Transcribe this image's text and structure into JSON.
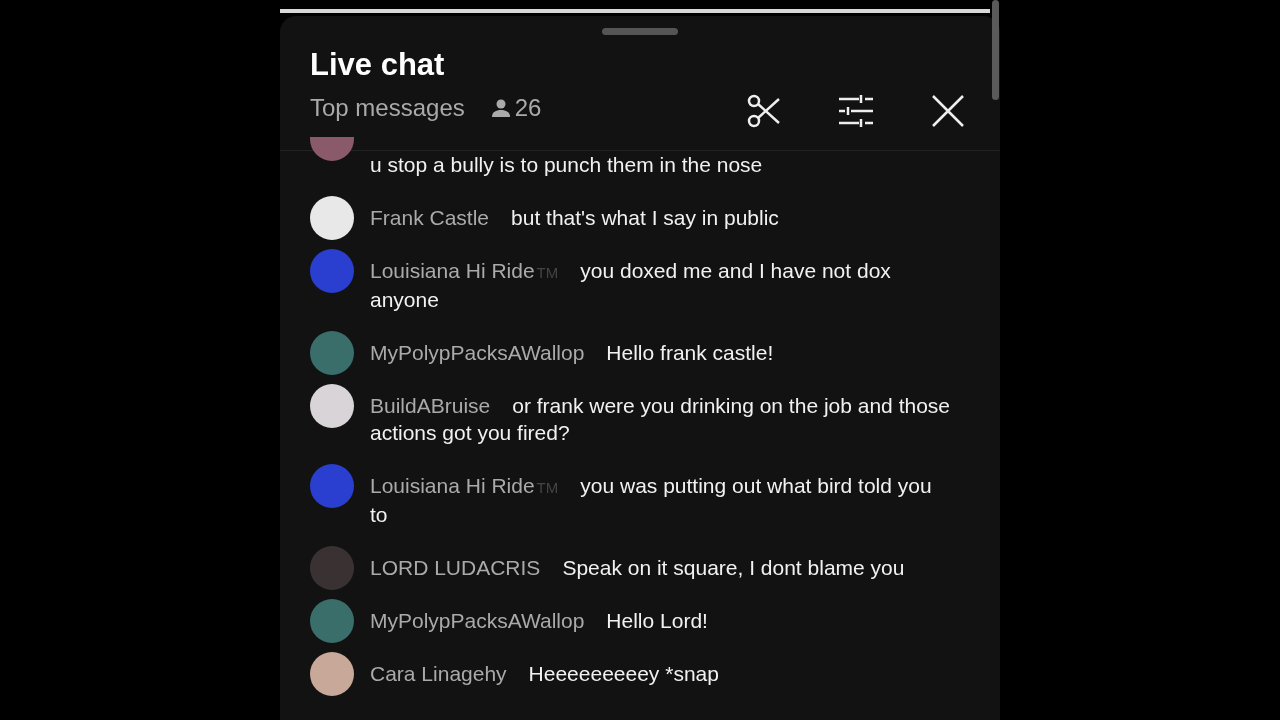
{
  "header": {
    "title": "Live chat",
    "filter": "Top messages",
    "viewer_count": "26"
  },
  "messages": [
    {
      "kind": "cut",
      "text": "u stop a bully is to punch them in the nose",
      "color": "#8a5a6a"
    },
    {
      "kind": "full",
      "author": "Frank Castle",
      "text": "but that's what I say in public",
      "color": "#e8e8e8"
    },
    {
      "kind": "full",
      "author": "Louisiana Hi Ride",
      "badge": "TM",
      "text": "you doxed me and I have not dox anyone",
      "color": "#2a3fd0"
    },
    {
      "kind": "full",
      "author": "MyPolypPacksAWallop",
      "text": "Hello frank castle!",
      "color": "#3a6e6a"
    },
    {
      "kind": "full",
      "author": "BuildABruise",
      "text": "or frank were you drinking on the job and those actions got you fired?",
      "color": "#d8d4d8"
    },
    {
      "kind": "full",
      "author": "Louisiana Hi Ride",
      "badge": "TM",
      "text": "you was putting out what bird told you to",
      "color": "#2a3fd0"
    },
    {
      "kind": "full",
      "author": "LORD LUDACRIS",
      "text": "Speak on it square, I dont blame you",
      "color": "#3a3232"
    },
    {
      "kind": "full",
      "author": "MyPolypPacksAWallop",
      "text": "Hello Lord!",
      "color": "#3a6e6a"
    },
    {
      "kind": "full",
      "author": "Cara Linagehy",
      "text": "Heeeeeeeeey *snap",
      "color": "#c8a898"
    }
  ]
}
